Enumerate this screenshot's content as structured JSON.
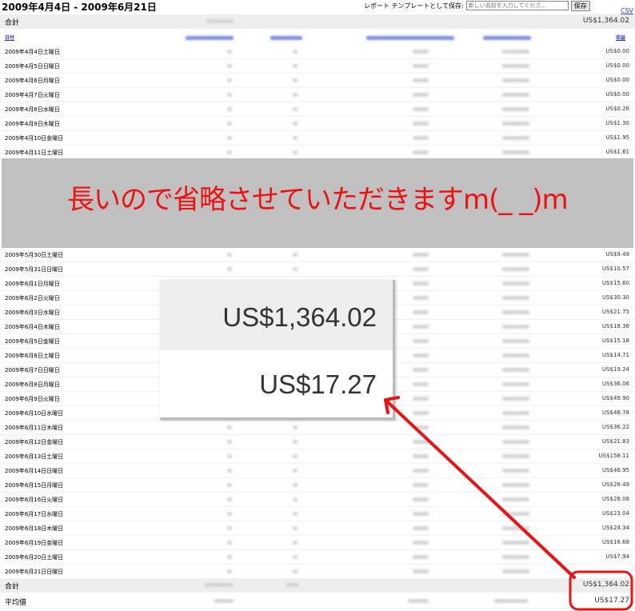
{
  "header": {
    "date_range": "2009年4月4日 - 2009年6月21日",
    "save_label": "レポート テンプレートとして保存:",
    "save_placeholder": "新しい名前を入力してくださ...",
    "save_button": "保存",
    "csv_link": "CSV"
  },
  "summary_top": {
    "label": "合計",
    "value": "US$1,364.02"
  },
  "columns": {
    "date": "日付",
    "revenue": "収益"
  },
  "rows_before": [
    {
      "date": "2009年4月4日土曜日",
      "value": "US$0.00"
    },
    {
      "date": "2009年4月5日日曜日",
      "value": "US$0.00"
    },
    {
      "date": "2009年4月6日月曜日",
      "value": "US$0.00"
    },
    {
      "date": "2009年4月7日火曜日",
      "value": "US$0.00"
    },
    {
      "date": "2009年4月8日水曜日",
      "value": "US$0.26"
    },
    {
      "date": "2009年4月9日木曜日",
      "value": "US$1.30"
    },
    {
      "date": "2009年4月10日金曜日",
      "value": "US$1.95"
    },
    {
      "date": "2009年4月11日土曜日",
      "value": "US$1.61"
    }
  ],
  "omission_note": "長いので省略させていただきますm(_ _)m",
  "rows_after": [
    {
      "date": "2009年5月30日土曜日",
      "value": "US$9.49"
    },
    {
      "date": "2009年5月31日日曜日",
      "value": "US$10.57"
    },
    {
      "date": "2009年6月1日月曜日",
      "value": "US$15.60"
    },
    {
      "date": "2009年6月2日火曜日",
      "value": "US$30.30"
    },
    {
      "date": "2009年6月3日水曜日",
      "value": "US$21.75"
    },
    {
      "date": "2009年6月4日木曜日",
      "value": "US$18.36"
    },
    {
      "date": "2009年6月5日金曜日",
      "value": "US$15.18"
    },
    {
      "date": "2009年6月6日土曜日",
      "value": "US$14.71"
    },
    {
      "date": "2009年6月7日日曜日",
      "value": "US$19.24"
    },
    {
      "date": "2009年6月8日月曜日",
      "value": "US$36.06"
    },
    {
      "date": "2009年6月9日火曜日",
      "value": "US$49.90"
    },
    {
      "date": "2009年6月10日水曜日",
      "value": "US$48.78"
    },
    {
      "date": "2009年6月11日木曜日",
      "value": "US$36.22"
    },
    {
      "date": "2009年6月12日金曜日",
      "value": "US$21.83"
    },
    {
      "date": "2009年6月13日土曜日",
      "value": "US$158.11"
    },
    {
      "date": "2009年6月14日日曜日",
      "value": "US$46.95"
    },
    {
      "date": "2009年6月15日月曜日",
      "value": "US$28.49"
    },
    {
      "date": "2009年6月16日火曜日",
      "value": "US$28.08"
    },
    {
      "date": "2009年6月17日水曜日",
      "value": "US$23.04"
    },
    {
      "date": "2009年6月18日木曜日",
      "value": "US$24.34"
    },
    {
      "date": "2009年6月19日金曜日",
      "value": "US$16.68"
    },
    {
      "date": "2009年6月20日土曜日",
      "value": "US$7.94"
    },
    {
      "date": "2009年6月21日日曜日",
      "value": ""
    }
  ],
  "footer": {
    "total_label": "合計",
    "total_value": "US$1,364.02",
    "avg_label": "平均値",
    "avg_value": "US$17.27"
  },
  "zoom": {
    "total": "US$1,364.02",
    "average": "US$17.27"
  },
  "colors": {
    "annotation_red": "#ee1111",
    "link_blue": "#2233cc"
  }
}
